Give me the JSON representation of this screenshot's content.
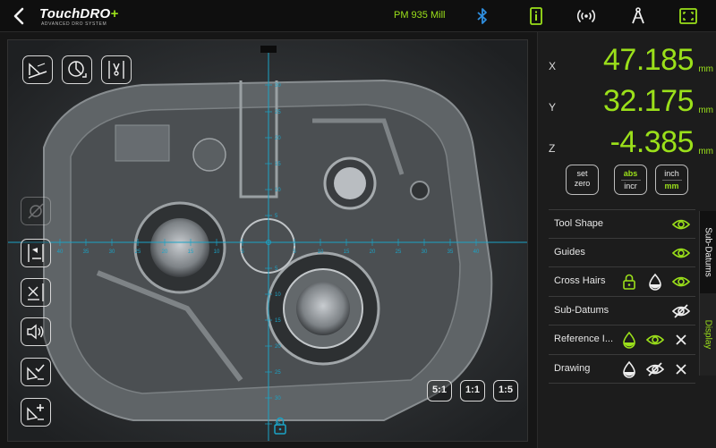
{
  "topbar": {
    "logo_main": "TouchDRO",
    "logo_plus": "+",
    "logo_sub": "ADVANCED DRO SYSTEM",
    "machine_name": "PM 935 Mill",
    "icons": [
      "back-arrow-icon",
      "bluetooth-icon",
      "info-icon",
      "broadcast-icon",
      "compass-icon",
      "fullscreen-icon"
    ]
  },
  "camera": {
    "zoom_buttons": [
      "5:1",
      "1:1",
      "1:5"
    ],
    "tool_icons_top": [
      "probe-tool-icon",
      "rotate-tool-icon",
      "edge-finder-icon"
    ],
    "tool_icons_left": [
      "disabled-tool-icon",
      "zero-point-icon",
      "rotate-axis-icon",
      "sound-icon",
      "check-offset-icon",
      "add-offset-icon"
    ],
    "scale_labels_h": [
      "40",
      "35",
      "30",
      "25",
      "20",
      "15",
      "10",
      "5",
      "5",
      "10",
      "15",
      "20",
      "25",
      "30",
      "35",
      "40"
    ],
    "scale_labels_v": [
      "30",
      "25",
      "20",
      "15",
      "10",
      "5",
      "5",
      "10",
      "15",
      "20",
      "25",
      "30",
      "35"
    ]
  },
  "dro": {
    "axes": [
      {
        "label": "X",
        "value": "47.185",
        "unit": "mm"
      },
      {
        "label": "Y",
        "value": "32.175",
        "unit": "mm"
      },
      {
        "label": "Z",
        "value": "-4.385",
        "unit": "mm"
      }
    ],
    "buttons": {
      "set_zero": {
        "line1": "set",
        "line2": "zero"
      },
      "abs_incr": {
        "line1": "abs",
        "line2": "incr"
      },
      "inch_mm": {
        "line1": "inch",
        "line2": "mm"
      }
    }
  },
  "display_options": [
    {
      "label": "Tool Shape",
      "icons": [
        "eye-icon"
      ]
    },
    {
      "label": "Guides",
      "icons": [
        "eye-icon"
      ]
    },
    {
      "label": "Cross Hairs",
      "icons": [
        "lock-icon",
        "opacity-icon",
        "eye-icon"
      ]
    },
    {
      "label": "Sub-Datums",
      "icons": [
        "eye-off-icon"
      ]
    },
    {
      "label": "Reference I...",
      "icons": [
        "opacity-icon",
        "eye-icon",
        "close-icon"
      ]
    },
    {
      "label": "Drawing",
      "icons": [
        "opacity-icon",
        "eye-off-icon",
        "close-icon"
      ]
    }
  ],
  "side_tabs": [
    {
      "label": "Sub-Datums",
      "active": true
    },
    {
      "label": "Display",
      "active": false
    }
  ],
  "colors": {
    "accent_green": "#9be01a",
    "accent_cyan": "#1ba3c6",
    "bluetooth_blue": "#2f8fe0"
  }
}
